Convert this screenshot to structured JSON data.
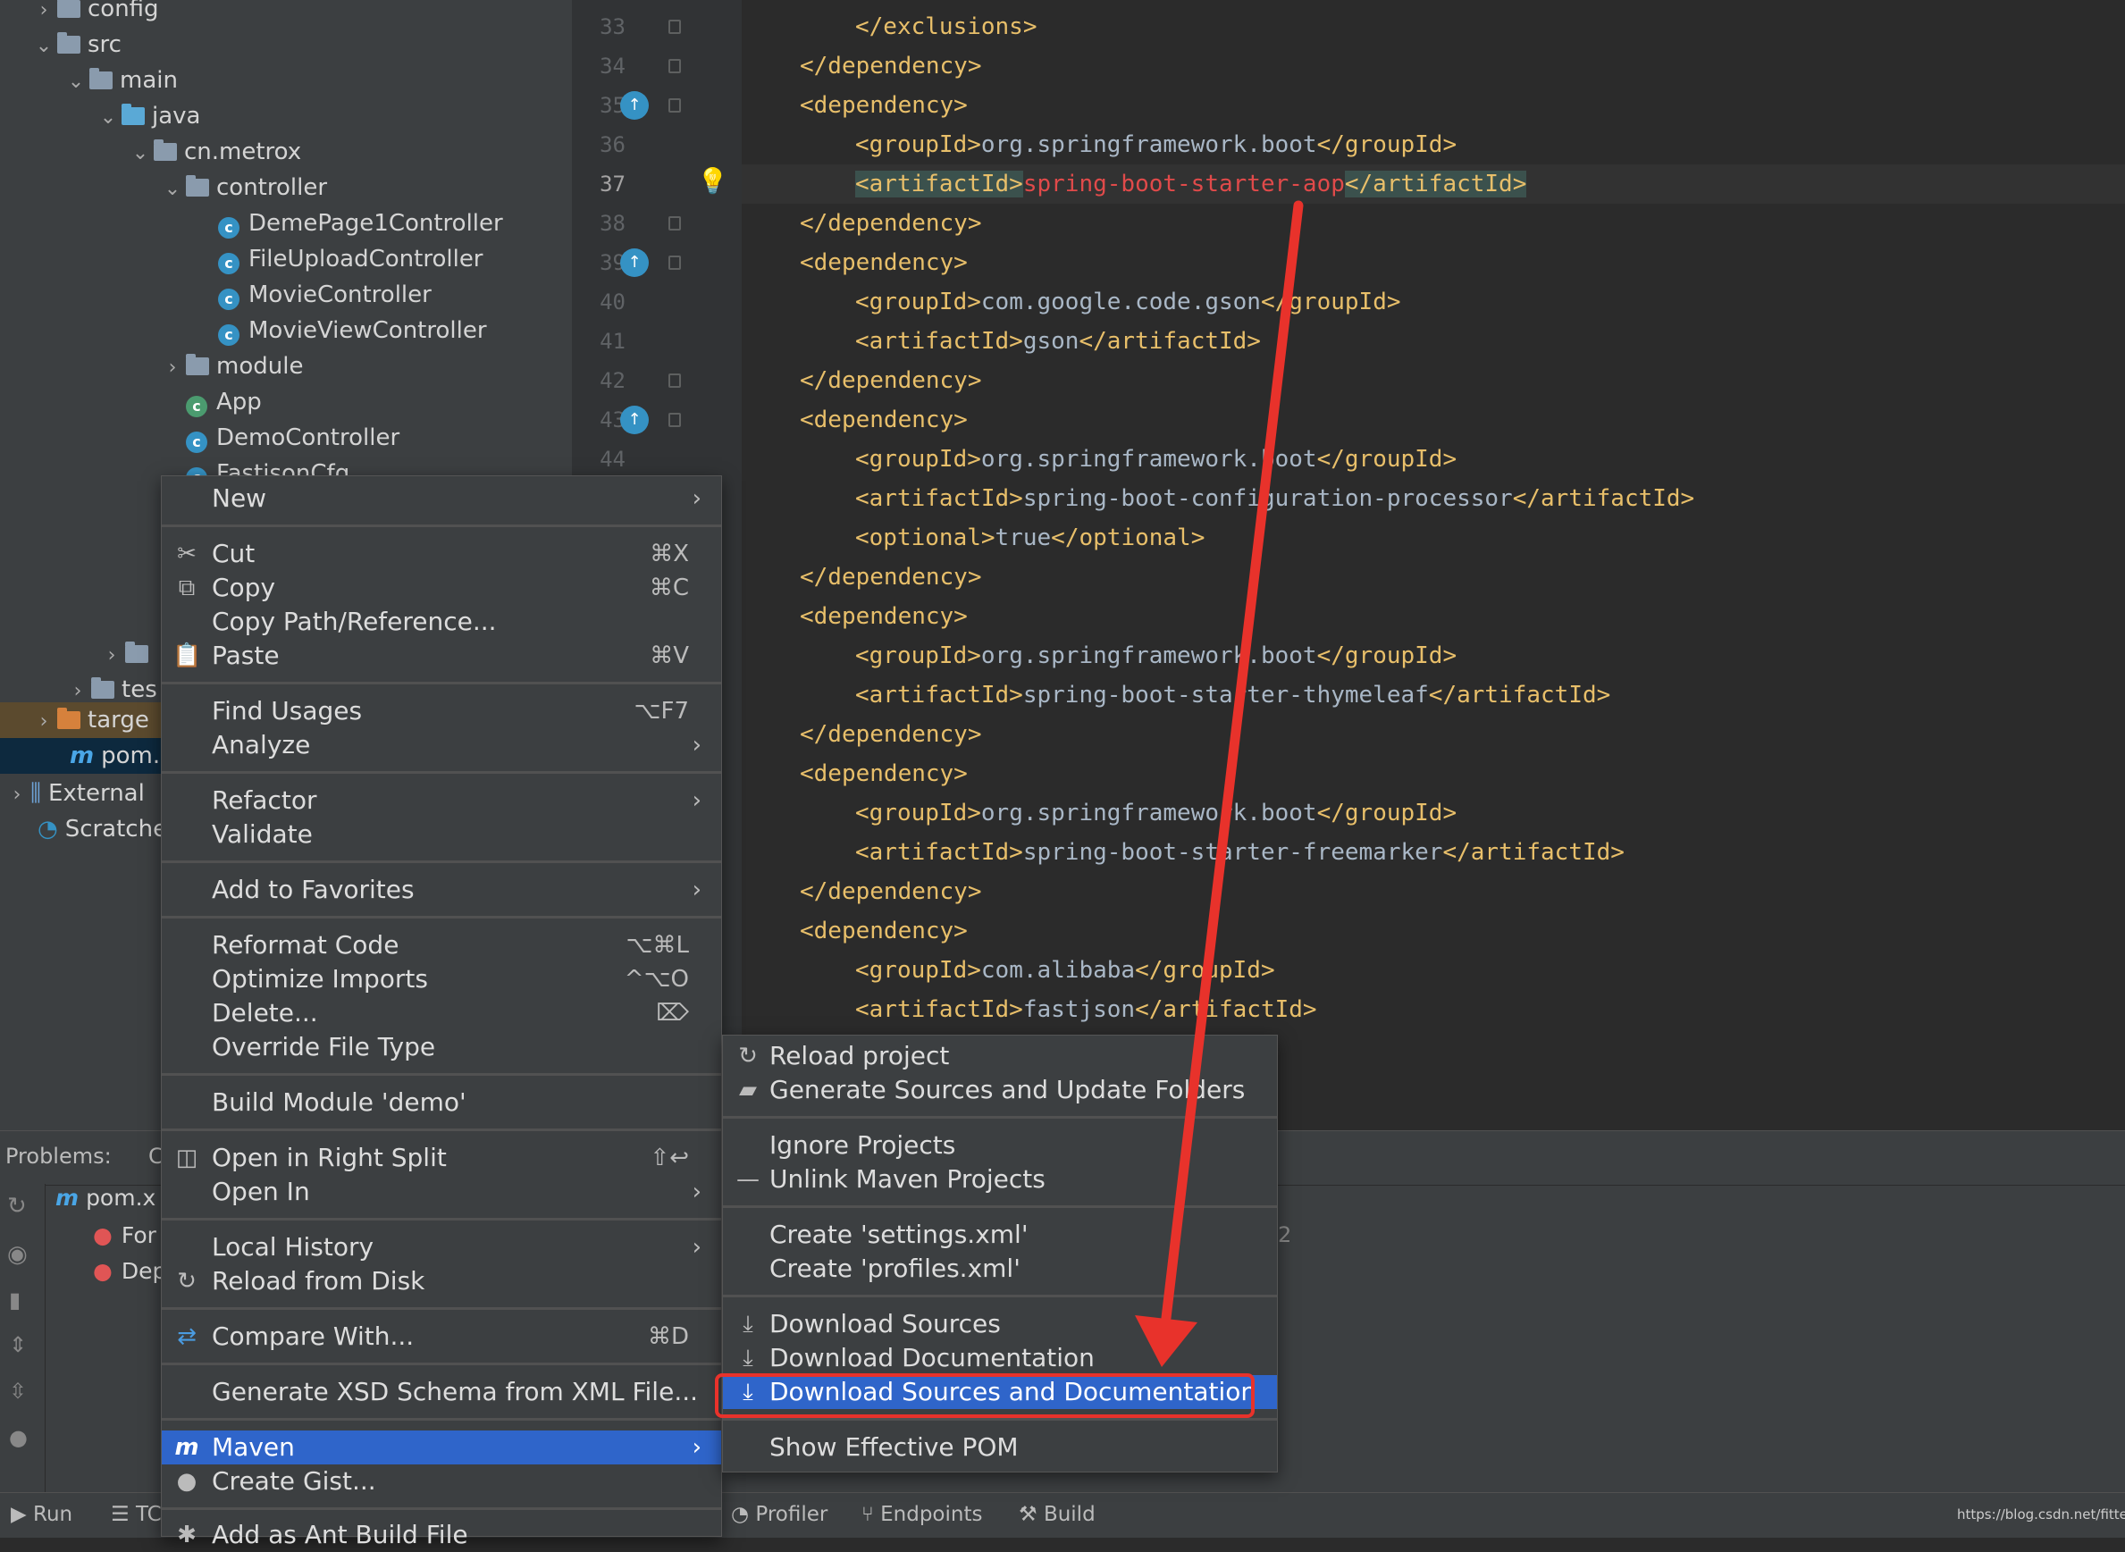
{
  "project_tree": [
    {
      "label": "config",
      "depth": 1,
      "expanded": false,
      "icon": "folder-icon"
    },
    {
      "label": "src",
      "depth": 1,
      "expanded": true,
      "icon": "folder-icon"
    },
    {
      "label": "main",
      "depth": 2,
      "expanded": true,
      "icon": "folder-icon"
    },
    {
      "label": "java",
      "depth": 3,
      "expanded": true,
      "icon": "source-folder-icon"
    },
    {
      "label": "cn.metrox",
      "depth": 4,
      "expanded": true,
      "icon": "package-icon"
    },
    {
      "label": "controller",
      "depth": 5,
      "expanded": true,
      "icon": "package-icon"
    },
    {
      "label": "DemePage1Controller",
      "depth": 6,
      "icon": "class-icon"
    },
    {
      "label": "FileUploadController",
      "depth": 6,
      "icon": "class-icon"
    },
    {
      "label": "MovieController",
      "depth": 6,
      "icon": "class-icon"
    },
    {
      "label": "MovieViewController",
      "depth": 6,
      "icon": "class-icon"
    },
    {
      "label": "module",
      "depth": 5,
      "expanded": false,
      "icon": "package-icon"
    },
    {
      "label": "App",
      "depth": 5,
      "icon": "spring-class-icon"
    },
    {
      "label": "DemoController",
      "depth": 5,
      "icon": "class-icon"
    },
    {
      "label": "FastisonCfg",
      "depth": 5,
      "icon": "class-icon"
    }
  ],
  "tree_partial": {
    "tes": "tes",
    "target": "targe",
    "pom": "pom.",
    "external": "External",
    "scratches": "Scratche"
  },
  "gutter": {
    "line_numbers": [
      "33",
      "34",
      "35",
      "36",
      "37",
      "38",
      "39",
      "40",
      "41",
      "42",
      "43",
      "44"
    ],
    "current_line": "37"
  },
  "code_lines": [
    {
      "indent": 2,
      "parts": [
        {
          "t": "tag",
          "v": "</exclusions>"
        }
      ]
    },
    {
      "indent": 1,
      "parts": [
        {
          "t": "tag",
          "v": "</dependency>"
        }
      ]
    },
    {
      "indent": 1,
      "parts": [
        {
          "t": "tag",
          "v": "<dependency>"
        }
      ]
    },
    {
      "indent": 2,
      "parts": [
        {
          "t": "tag",
          "v": "<groupId>"
        },
        {
          "t": "txt",
          "v": "org.springframework.boot"
        },
        {
          "t": "tag",
          "v": "</groupId>"
        }
      ]
    },
    {
      "indent": 2,
      "parts": [
        {
          "t": "tag hl",
          "v": "<artifactId>"
        },
        {
          "t": "err",
          "v": "spring-boot-starter-aop"
        },
        {
          "t": "tag hl",
          "v": "</artifactId>"
        }
      ]
    },
    {
      "indent": 1,
      "parts": [
        {
          "t": "tag",
          "v": "</dependency>"
        }
      ]
    },
    {
      "indent": 1,
      "parts": [
        {
          "t": "tag",
          "v": "<dependency>"
        }
      ]
    },
    {
      "indent": 2,
      "parts": [
        {
          "t": "tag",
          "v": "<groupId>"
        },
        {
          "t": "txt",
          "v": "com.google.code.gson"
        },
        {
          "t": "tag",
          "v": "</groupId>"
        }
      ]
    },
    {
      "indent": 2,
      "parts": [
        {
          "t": "tag",
          "v": "<artifactId>"
        },
        {
          "t": "txt",
          "v": "gson"
        },
        {
          "t": "tag",
          "v": "</artifactId>"
        }
      ]
    },
    {
      "indent": 1,
      "parts": [
        {
          "t": "tag",
          "v": "</dependency>"
        }
      ]
    },
    {
      "indent": 1,
      "parts": [
        {
          "t": "tag",
          "v": "<dependency>"
        }
      ]
    },
    {
      "indent": 2,
      "parts": [
        {
          "t": "tag",
          "v": "<groupId>"
        },
        {
          "t": "txt",
          "v": "org.springframework.boot"
        },
        {
          "t": "tag",
          "v": "</groupId>"
        }
      ]
    },
    {
      "indent": 2,
      "parts": [
        {
          "t": "tag",
          "v": "<artifactId>"
        },
        {
          "t": "txt",
          "v": "spring-boot-configuration-processor"
        },
        {
          "t": "tag",
          "v": "</artifactId>"
        }
      ]
    },
    {
      "indent": 2,
      "parts": [
        {
          "t": "tag",
          "v": "<optional>"
        },
        {
          "t": "txt",
          "v": "true"
        },
        {
          "t": "tag",
          "v": "</optional>"
        }
      ]
    },
    {
      "indent": 1,
      "parts": [
        {
          "t": "tag",
          "v": "</dependency>"
        }
      ]
    },
    {
      "indent": 1,
      "parts": [
        {
          "t": "tag",
          "v": "<dependency>"
        }
      ]
    },
    {
      "indent": 2,
      "parts": [
        {
          "t": "tag",
          "v": "<groupId>"
        },
        {
          "t": "txt",
          "v": "org.springframework.boot"
        },
        {
          "t": "tag",
          "v": "</groupId>"
        }
      ]
    },
    {
      "indent": 2,
      "parts": [
        {
          "t": "tag",
          "v": "<artifactId>"
        },
        {
          "t": "txt",
          "v": "spring-boot-starter-thymeleaf"
        },
        {
          "t": "tag",
          "v": "</artifactId>"
        }
      ]
    },
    {
      "indent": 1,
      "parts": [
        {
          "t": "tag",
          "v": "</dependency>"
        }
      ]
    },
    {
      "indent": 1,
      "parts": [
        {
          "t": "tag",
          "v": "<dependency>"
        }
      ]
    },
    {
      "indent": 2,
      "parts": [
        {
          "t": "tag",
          "v": "<groupId>"
        },
        {
          "t": "txt",
          "v": "org.springframework.boot"
        },
        {
          "t": "tag",
          "v": "</groupId>"
        }
      ]
    },
    {
      "indent": 2,
      "parts": [
        {
          "t": "tag",
          "v": "<artifactId>"
        },
        {
          "t": "txt",
          "v": "spring-boot-starter-freemarker"
        },
        {
          "t": "tag",
          "v": "</artifactId>"
        }
      ]
    },
    {
      "indent": 1,
      "parts": [
        {
          "t": "tag",
          "v": "</dependency>"
        }
      ]
    },
    {
      "indent": 1,
      "parts": [
        {
          "t": "tag",
          "v": "<dependency>"
        }
      ]
    },
    {
      "indent": 2,
      "parts": [
        {
          "t": "tag",
          "v": "<groupId>"
        },
        {
          "t": "txt",
          "v": "com.alibaba"
        },
        {
          "t": "tag",
          "v": "</groupId>"
        }
      ]
    },
    {
      "indent": 2,
      "parts": [
        {
          "t": "tag",
          "v": "<artifactId>"
        },
        {
          "t": "txt",
          "v": "fastjson"
        },
        {
          "t": "tag",
          "v": "</artifactId>"
        }
      ]
    }
  ],
  "bottom_panel": {
    "problems_label": "Problems:",
    "tab_partial": "C",
    "file_partial": "pom.x",
    "error1_partial": "For",
    "error2_partial": "Dep",
    "count_partial": "2"
  },
  "statusbar": {
    "run": "Run",
    "todo_partial": "TC",
    "profiler": "Profiler",
    "endpoints": "Endpoints",
    "build": "Build",
    "watermark": "https://blog.csdn.net/fittec"
  },
  "context_menu": {
    "new": "New",
    "cut": "Cut",
    "cut_sc": "⌘X",
    "copy": "Copy",
    "copy_sc": "⌘C",
    "copy_path": "Copy Path/Reference...",
    "paste": "Paste",
    "paste_sc": "⌘V",
    "find_usages": "Find Usages",
    "find_usages_sc": "⌥F7",
    "analyze": "Analyze",
    "refactor": "Refactor",
    "validate": "Validate",
    "add_favorites": "Add to Favorites",
    "reformat": "Reformat Code",
    "reformat_sc": "⌥⌘L",
    "optimize": "Optimize Imports",
    "optimize_sc": "^⌥O",
    "delete": "Delete...",
    "delete_sc": "⌦",
    "override": "Override File Type",
    "build_module": "Build Module 'demo'",
    "open_right": "Open in Right Split",
    "open_right_sc": "⇧↩",
    "open_in": "Open In",
    "local_history": "Local History",
    "reload_disk": "Reload from Disk",
    "compare": "Compare With...",
    "compare_sc": "⌘D",
    "gen_xsd": "Generate XSD Schema from XML File...",
    "maven": "Maven",
    "create_gist": "Create Gist...",
    "add_ant": "Add as Ant Build File"
  },
  "maven_submenu": {
    "reload": "Reload project",
    "generate": "Generate Sources and Update Folders",
    "ignore": "Ignore Projects",
    "unlink": "Unlink Maven Projects",
    "create_settings": "Create 'settings.xml'",
    "create_profiles": "Create 'profiles.xml'",
    "download_sources": "Download Sources",
    "download_docs": "Download Documentation",
    "download_both": "Download Sources and Documentation",
    "show_pom": "Show Effective POM"
  },
  "colors": {
    "selection": "#2f65ca",
    "annotation_red": "#e8322b",
    "tag": "#e8bf6a",
    "text": "#a9b7c6"
  }
}
